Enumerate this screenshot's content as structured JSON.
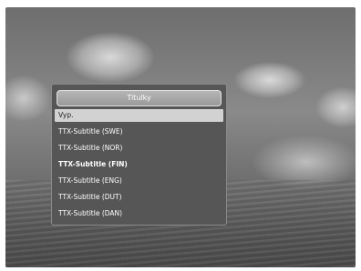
{
  "subtitle_menu": {
    "title": "Titulky",
    "options": [
      {
        "label": "Vyp.",
        "selected": true
      },
      {
        "label": "TTX-Subtitle (SWE)",
        "selected": false
      },
      {
        "label": "TTX-Subtitle (NOR)",
        "selected": false
      },
      {
        "label": "TTX-Subtitle (FIN)",
        "selected": false
      },
      {
        "label": "TTX-Subtitle (ENG)",
        "selected": false
      },
      {
        "label": "TTX-Subtitle (DUT)",
        "selected": false
      },
      {
        "label": "TTX-Subtitle (DAN)",
        "selected": false
      }
    ]
  },
  "colors": {
    "dialog_bg": "#565656",
    "title_bar": "#9a9a9a",
    "selection": "#d2d2d2"
  }
}
